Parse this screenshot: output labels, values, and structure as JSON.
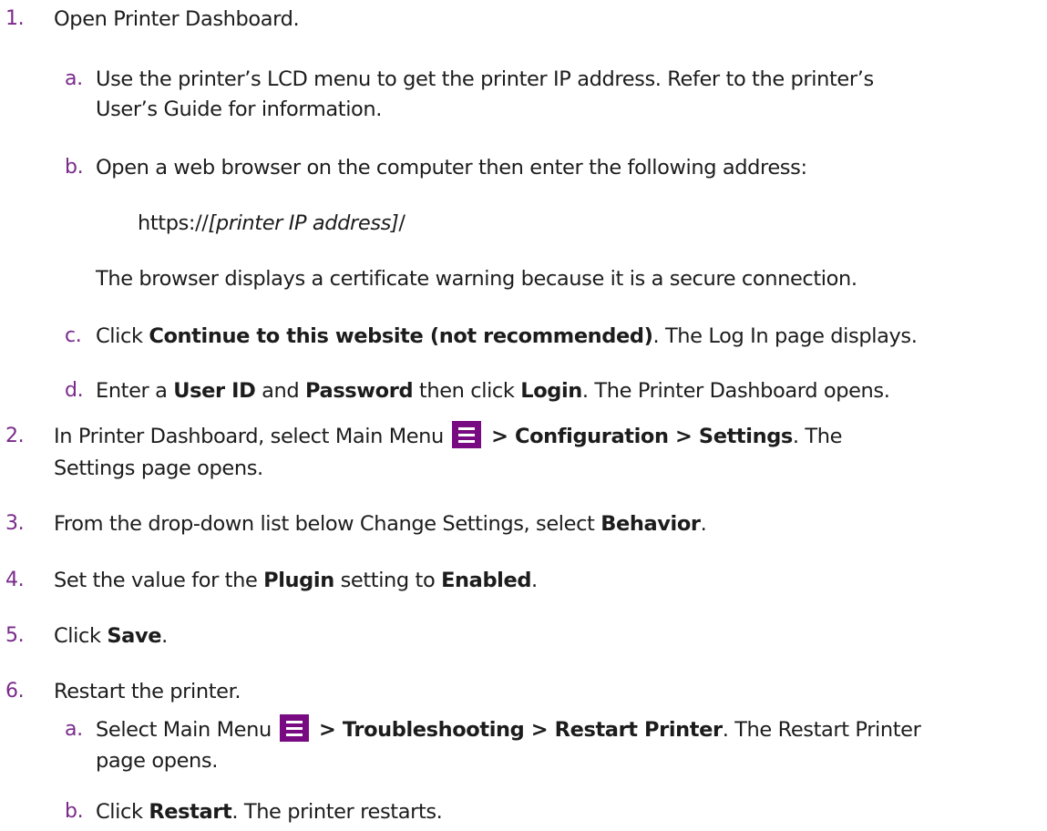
{
  "steps": [
    {
      "num": "1.",
      "text": "Open Printer Dashboard.",
      "substeps": [
        {
          "num": "a.",
          "line1": "Use the printer’s LCD menu to get the printer IP address. Refer to the printer’s",
          "line2": "User’s Guide for information."
        },
        {
          "num": "b.",
          "text": "Open a web browser on the computer then enter the following address:",
          "url_prefix": "https://",
          "url_var": "[printer IP address]",
          "url_suffix": "/",
          "note": "The browser displays a certificate warning because it is a secure connection."
        },
        {
          "num": "c.",
          "pre": "Click ",
          "bold": "Continue to this website (not recommended)",
          "post": ". The Log In page displays."
        },
        {
          "num": "d.",
          "pre": "Enter a ",
          "bold1": "User ID",
          "mid1": " and ",
          "bold2": "Password",
          "mid2": " then click ",
          "bold3": "Login",
          "post": ". The Printer Dashboard opens."
        }
      ]
    },
    {
      "num": "2.",
      "pre": "In Printer Dashboard, select Main Menu",
      "icon": "menu-icon",
      "bold": " > Configuration > Settings",
      "post": ". The",
      "line2": "Settings page opens."
    },
    {
      "num": "3.",
      "pre": "From the drop-down list below Change Settings, select ",
      "bold": "Behavior",
      "post": "."
    },
    {
      "num": "4.",
      "pre": "Set the value for the ",
      "bold1": "Plugin",
      "mid": " setting to ",
      "bold2": "Enabled",
      "post": "."
    },
    {
      "num": "5.",
      "pre": "Click ",
      "bold": "Save",
      "post": "."
    },
    {
      "num": "6.",
      "text": "Restart the printer.",
      "substeps": [
        {
          "num": "a.",
          "pre": "Select Main Menu",
          "icon": "menu-icon",
          "bold": " > Troubleshooting > Restart Printer",
          "post": ". The Restart Printer",
          "line2": "page opens."
        },
        {
          "num": "b.",
          "pre": "Click ",
          "bold": "Restart",
          "post": ". The printer restarts."
        }
      ]
    }
  ],
  "colors": {
    "number": "#7a2a8a",
    "menu_icon_bg": "#780b82",
    "text": "#1c1c1c"
  }
}
